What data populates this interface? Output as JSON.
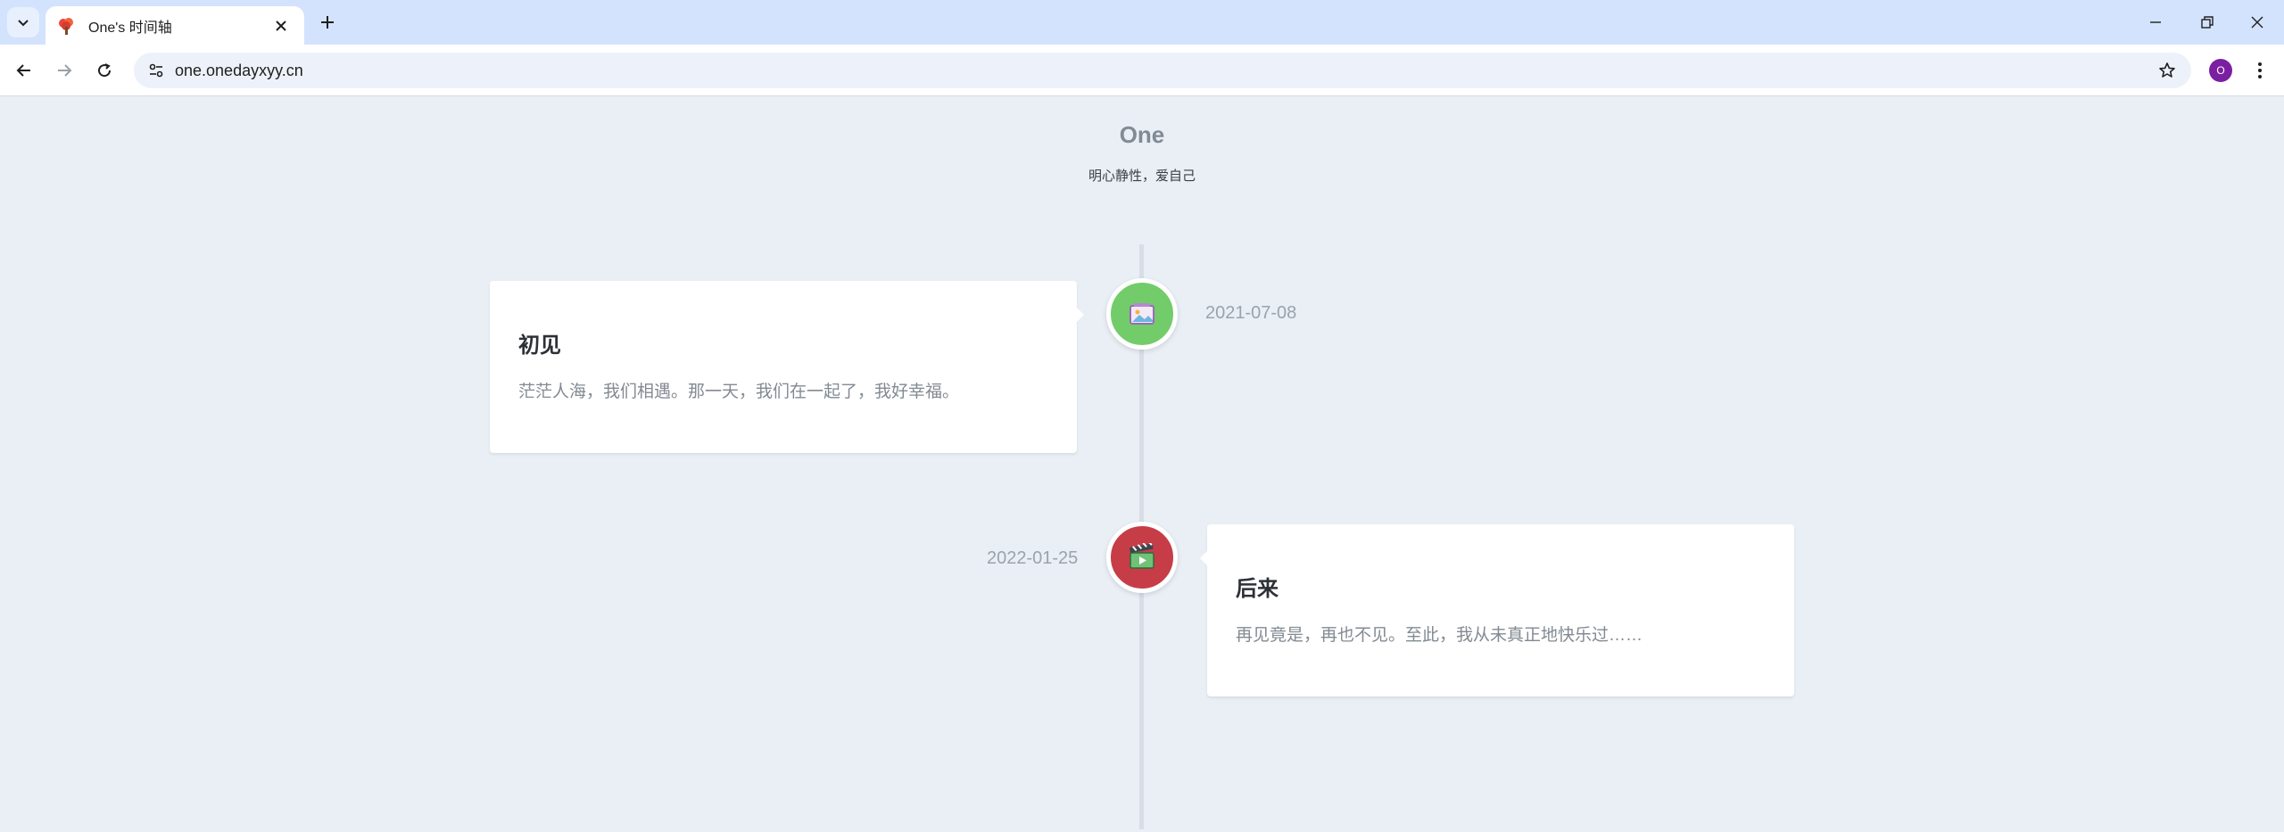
{
  "browser": {
    "tab_title": "One's 时间轴",
    "url": "one.onedayxyy.cn",
    "profile_initial": "O"
  },
  "site": {
    "title": "One",
    "motto": "明心静性，爱自己"
  },
  "timeline": [
    {
      "title": "初见",
      "text": "茫茫人海，我们相遇。那一天，我们在一起了，我好幸福。",
      "date": "2021-07-08",
      "icon": "photo-icon",
      "node_color": "#72cc6a"
    },
    {
      "title": "后来",
      "text": "再见竟是，再也不见。至此，我从未真正地快乐过……",
      "date": "2022-01-25",
      "icon": "film-clapper-icon",
      "node_color": "#c63d48"
    }
  ]
}
